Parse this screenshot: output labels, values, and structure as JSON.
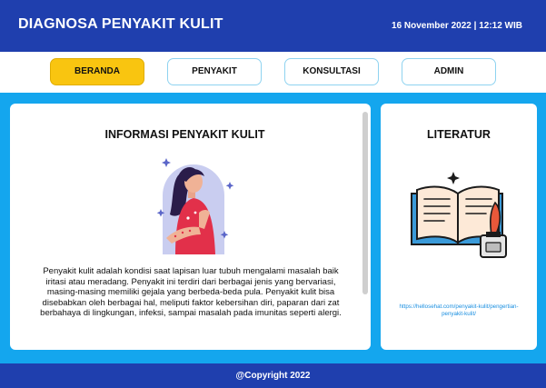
{
  "header": {
    "title": "DIAGNOSA PENYAKIT KULIT",
    "datetime": "16 November 2022 | 12:12 WIB"
  },
  "nav": {
    "items": [
      {
        "label": "BERANDA",
        "active": true
      },
      {
        "label": "PENYAKIT",
        "active": false
      },
      {
        "label": "KONSULTASI",
        "active": false
      },
      {
        "label": "ADMIN",
        "active": false
      }
    ]
  },
  "info": {
    "title": "INFORMASI PENYAKIT KULIT",
    "description": "Penyakit kulit adalah kondisi saat lapisan luar tubuh mengalami masalah baik iritasi atau meradang. Penyakit ini terdiri dari berbagai jenis yang bervariasi, masing-masing memiliki gejala yang berbeda-beda pula. Penyakit kulit bisa disebabkan oleh berbagai hal, meliputi faktor kebersihan diri, paparan dari zat berbahaya di lingkungan, infeksi, sampai masalah pada imunitas seperti alergi."
  },
  "literature": {
    "title": "LITERATUR",
    "link": "https://hellosehat.com/penyakit-kulit/pengertian-penyakit-kulit/"
  },
  "footer": {
    "copyright": "@Copyright 2022"
  },
  "colors": {
    "header_bg": "#1f3fae",
    "content_bg": "#14a6ee",
    "active_nav": "#f9c510",
    "nav_border": "#8fd3f0"
  },
  "icons": {
    "illustration": "woman-scratching-skin-illustration",
    "book": "open-book-with-quill-icon"
  }
}
